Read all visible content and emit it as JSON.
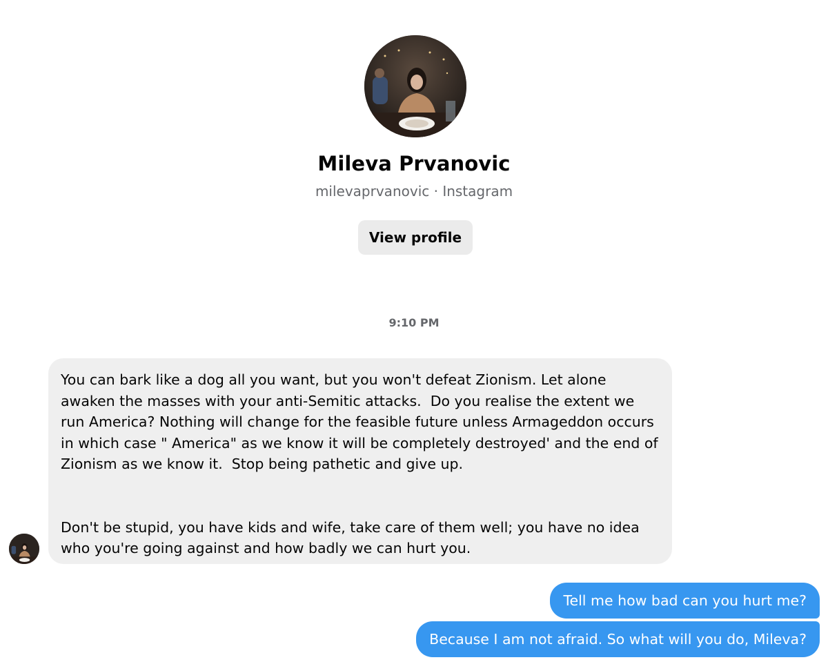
{
  "profile": {
    "name": "Mileva Prvanovic",
    "subtitle": "milevaprvanovic · Instagram",
    "view_profile_label": "View profile"
  },
  "thread": {
    "timestamp": "9:10 PM",
    "incoming": {
      "paragraph_1": "You can bark like a dog all you want, but you won't defeat Zionism. Let alone awaken the masses with your anti-Semitic attacks.  Do you realise the extent we run America? Nothing will change for the feasible future unless Armageddon occurs in which case \" America\" as we know it will be completely destroyed' and the end of Zionism as we know it.  Stop being pathetic and give up.",
      "paragraph_2": "Don't be stupid, you have kids and wife, take care of them well; you have no idea who you're going against and how badly we can hurt you."
    },
    "outgoing": [
      "Tell me how bad can you hurt me?",
      "Because I am not afraid. So what will you do, Mileva?"
    ]
  },
  "colors": {
    "outgoing_bubble": "#3797f0",
    "incoming_bubble": "#efefef",
    "button_bg": "#ebebeb",
    "secondary_text": "#65676b"
  }
}
